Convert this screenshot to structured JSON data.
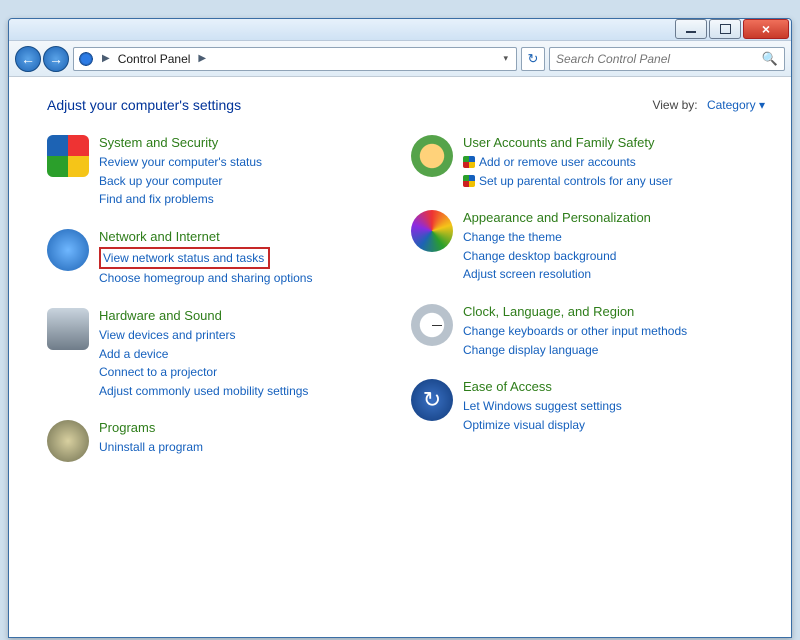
{
  "window": {
    "breadcrumb_root": "Control Panel",
    "search_placeholder": "Search Control Panel"
  },
  "header": {
    "title": "Adjust your computer's settings",
    "viewby_label": "View by:",
    "viewby_value": "Category"
  },
  "left": [
    {
      "title": "System and Security",
      "icon": "i-sys",
      "links": [
        {
          "label": "Review your computer's status",
          "shield": false
        },
        {
          "label": "Back up your computer",
          "shield": false
        },
        {
          "label": "Find and fix problems",
          "shield": false
        }
      ]
    },
    {
      "title": "Network and Internet",
      "icon": "i-net",
      "links": [
        {
          "label": "View network status and tasks",
          "shield": false,
          "highlight": true
        },
        {
          "label": "Choose homegroup and sharing options",
          "shield": false
        }
      ]
    },
    {
      "title": "Hardware and Sound",
      "icon": "i-hw",
      "links": [
        {
          "label": "View devices and printers",
          "shield": false
        },
        {
          "label": "Add a device",
          "shield": false
        },
        {
          "label": "Connect to a projector",
          "shield": false
        },
        {
          "label": "Adjust commonly used mobility settings",
          "shield": false
        }
      ]
    },
    {
      "title": "Programs",
      "icon": "i-prog",
      "links": [
        {
          "label": "Uninstall a program",
          "shield": false
        }
      ]
    }
  ],
  "right": [
    {
      "title": "User Accounts and Family Safety",
      "icon": "i-user",
      "links": [
        {
          "label": "Add or remove user accounts",
          "shield": true
        },
        {
          "label": "Set up parental controls for any user",
          "shield": true
        }
      ]
    },
    {
      "title": "Appearance and Personalization",
      "icon": "i-app",
      "links": [
        {
          "label": "Change the theme",
          "shield": false
        },
        {
          "label": "Change desktop background",
          "shield": false
        },
        {
          "label": "Adjust screen resolution",
          "shield": false
        }
      ]
    },
    {
      "title": "Clock, Language, and Region",
      "icon": "i-clk",
      "links": [
        {
          "label": "Change keyboards or other input methods",
          "shield": false
        },
        {
          "label": "Change display language",
          "shield": false
        }
      ]
    },
    {
      "title": "Ease of Access",
      "icon": "i-ease",
      "links": [
        {
          "label": "Let Windows suggest settings",
          "shield": false
        },
        {
          "label": "Optimize visual display",
          "shield": false
        }
      ]
    }
  ]
}
